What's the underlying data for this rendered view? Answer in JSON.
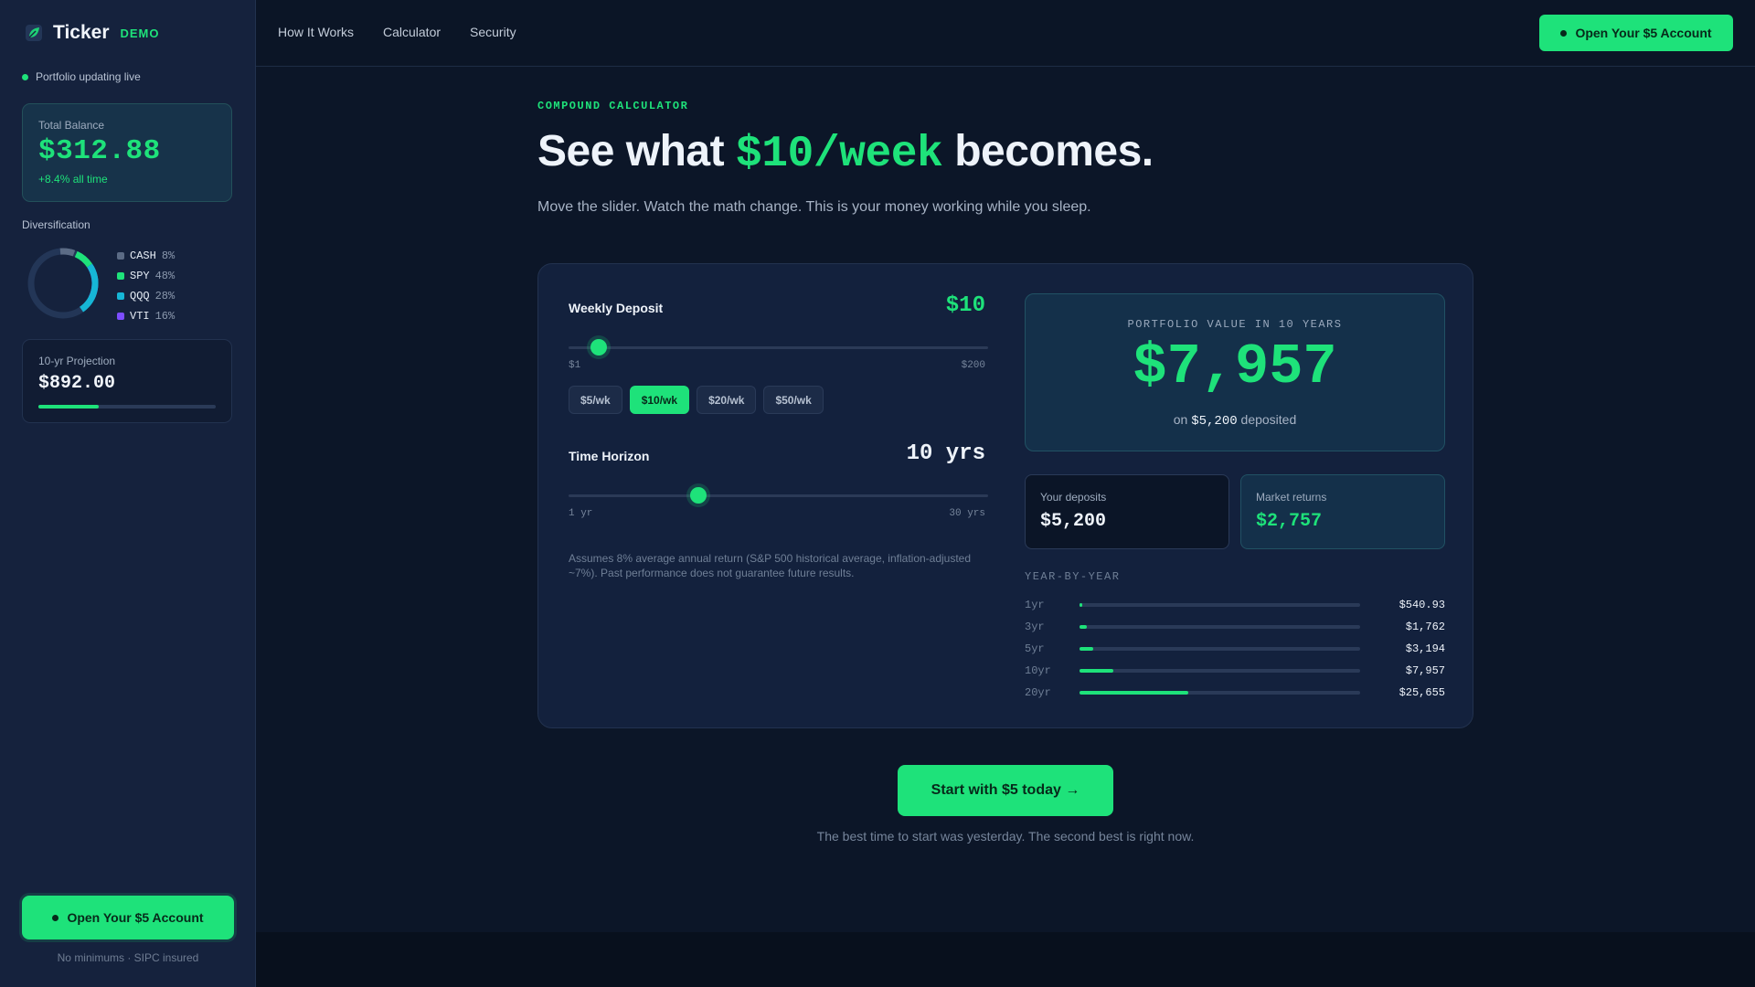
{
  "sidebar": {
    "brand_name": "Ticker",
    "brand_badge": "DEMO",
    "live_status": "Portfolio updating live",
    "balance": {
      "label": "Total Balance",
      "value": "$312.88",
      "change": "+8.4% all time"
    },
    "diversification": {
      "title": "Diversification",
      "items": [
        {
          "symbol": "CASH",
          "pct": "8%",
          "color": "#5b6b85",
          "share": 0.08
        },
        {
          "symbol": "SPY",
          "pct": "48%",
          "color": "#1ee27a",
          "share": 0.48
        },
        {
          "symbol": "QQQ",
          "pct": "28%",
          "color": "#16b6d6",
          "share": 0.28
        },
        {
          "symbol": "VTI",
          "pct": "16%",
          "color": "#7c4dff",
          "share": 0.16
        }
      ]
    },
    "projection": {
      "label": "10-yr Projection",
      "value": "$892.00",
      "progress": 0.34
    },
    "cta_label": "Open Your $5 Account",
    "footnote": "No minimums · SIPC insured"
  },
  "nav": {
    "links": [
      "How It Works",
      "Calculator",
      "Security"
    ],
    "cta_label": "Open Your $5 Account"
  },
  "hero": {
    "eyebrow": "COMPOUND CALCULATOR",
    "headline_pre": "See what ",
    "headline_highlight": "$10/week",
    "headline_post": " becomes.",
    "subhead": "Move the slider. Watch the math change. This is your money working while you sleep."
  },
  "calculator": {
    "deposit": {
      "label": "Weekly Deposit",
      "value": "$10",
      "min_label": "$1",
      "max_label": "$200",
      "min": 1,
      "max": 200,
      "current": 10,
      "chips": [
        {
          "label": "$5/wk",
          "active": false
        },
        {
          "label": "$10/wk",
          "active": true
        },
        {
          "label": "$20/wk",
          "active": false
        },
        {
          "label": "$50/wk",
          "active": false
        }
      ]
    },
    "horizon": {
      "label": "Time Horizon",
      "value": "10 yrs",
      "min_label": "1 yr",
      "max_label": "30 yrs",
      "min": 1,
      "max": 30,
      "current": 10
    },
    "disclaimer": "Assumes 8% average annual return (S&P 500 historical average, inflation-adjusted ~7%). Past performance does not guarantee future results.",
    "result": {
      "label": "PORTFOLIO VALUE IN 10 YEARS",
      "value": "$7,957",
      "sub_pre": "on ",
      "sub_amount": "$5,200",
      "sub_post": " deposited"
    },
    "deposits": {
      "label": "Your deposits",
      "value": "$5,200"
    },
    "returns": {
      "label": "Market returns",
      "value": "$2,757"
    },
    "year_by_year": {
      "title": "YEAR-BY-YEAR",
      "rows": [
        {
          "year": "1yr",
          "amount": "$540.93",
          "value": 540.93
        },
        {
          "year": "3yr",
          "amount": "$1,762",
          "value": 1762
        },
        {
          "year": "5yr",
          "amount": "$3,194",
          "value": 3194
        },
        {
          "year": "10yr",
          "amount": "$7,957",
          "value": 7957
        },
        {
          "year": "20yr",
          "amount": "$25,655",
          "value": 25655
        }
      ],
      "scale_max": 66000
    }
  },
  "cta": {
    "label": "Start with $5 today →",
    "note": "The best time to start was yesterday. The second best is right now."
  },
  "colors": {
    "accent": "#1ee27a",
    "background": "#0c1628",
    "sidebar": "#15223d",
    "card": "#13213d"
  }
}
